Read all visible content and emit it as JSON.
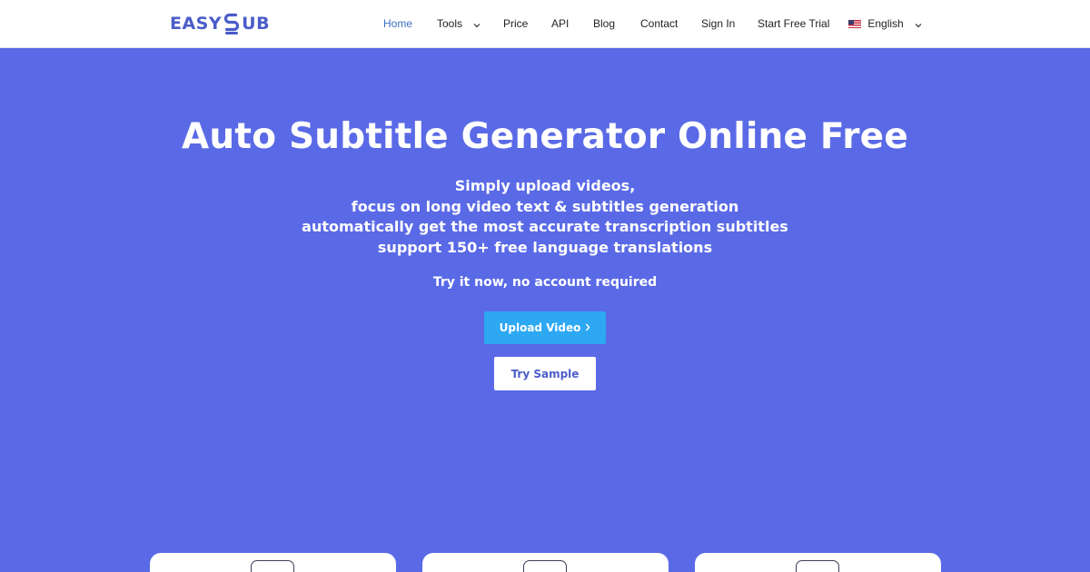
{
  "brand": {
    "logo_left": "EASY",
    "logo_right": "UB",
    "logo_mark_icon": "s-subtitle-logo-icon",
    "color": "#4a5cc9"
  },
  "nav": {
    "home": "Home",
    "tools": "Tools",
    "price": "Price",
    "api": "API",
    "blog": "Blog",
    "contact": "Contact",
    "sign_in": "Sign In",
    "start_free_trial": "Start Free Trial",
    "language": "English",
    "active_color": "#3b6fc0"
  },
  "hero": {
    "title": "Auto Subtitle Generator Online Free",
    "lines": [
      "Simply upload videos,",
      "focus on long video text & subtitles generation",
      "automatically get the most accurate transcription subtitles",
      "support 150+ free language translations"
    ],
    "try_text": "Try it now, no account required",
    "upload_button": "Upload Video",
    "sample_button": "Try Sample",
    "background": "#5a6ae6",
    "upload_color": "#2ea8f3"
  }
}
